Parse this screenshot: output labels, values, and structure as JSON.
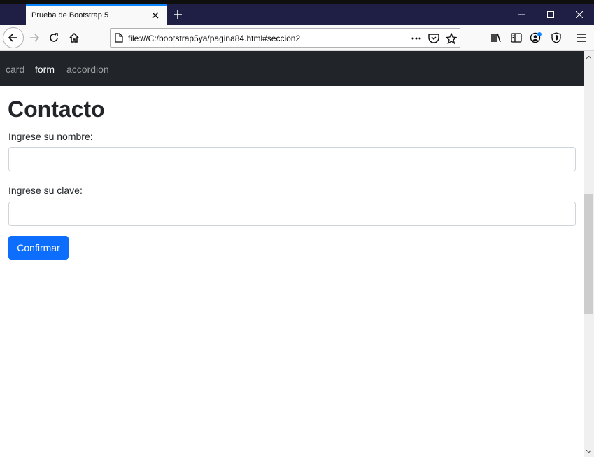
{
  "browser": {
    "tab": {
      "title": "Prueba de Bootstrap 5"
    },
    "url": "file:///C:/bootstrap5ya/pagina84.html#seccion2"
  },
  "icons": {
    "close_tab": "close-icon",
    "new_tab": "plus-icon",
    "minimize": "minimize-icon",
    "maximize": "maximize-icon",
    "close_window": "close-icon",
    "back": "arrow-left-icon",
    "forward": "arrow-right-icon",
    "reload": "reload-icon",
    "home": "home-icon",
    "page": "page-icon",
    "more": "more-horizontal-icon",
    "pocket": "pocket-icon",
    "bookmark": "star-icon",
    "library": "library-icon",
    "sidebar": "sidebar-icon",
    "account": "account-icon",
    "shield": "shield-icon",
    "menu": "hamburger-menu-icon"
  },
  "navbar": {
    "items": [
      {
        "label": "card",
        "active": false
      },
      {
        "label": "form",
        "active": true
      },
      {
        "label": "accordion",
        "active": false
      }
    ]
  },
  "form": {
    "title": "Contacto",
    "name_label": "Ingrese su nombre:",
    "name_value": "",
    "password_label": "Ingrese su clave:",
    "password_value": "",
    "submit_label": "Confirmar"
  },
  "colors": {
    "titlebar": "#1f1e44",
    "accent": "#0a84ff",
    "navbar": "#212529",
    "primary_button": "#0d6efd"
  }
}
